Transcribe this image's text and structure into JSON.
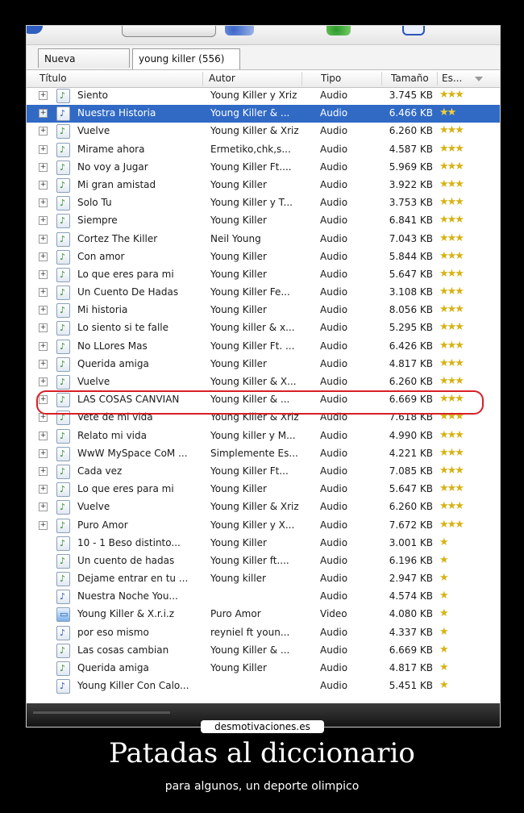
{
  "tabs": {
    "new_search": "Nueva búsqueda",
    "active": "young killer (556)"
  },
  "columns": {
    "title": "Título",
    "author": "Autor",
    "type": "Tipo",
    "size": "Tamaño",
    "status": "Es..."
  },
  "rows": [
    {
      "title": "Siento",
      "author": "Young Killer y Xriz",
      "type": "Audio",
      "size": "3.745 KB",
      "stars": 3,
      "expandable": true,
      "icon": "green"
    },
    {
      "title": "Nuestra Historia",
      "author": "Young Killer & ...",
      "type": "Audio",
      "size": "6.466 KB",
      "stars": 2,
      "expandable": true,
      "icon": "blue",
      "selected": true
    },
    {
      "title": "Vuelve",
      "author": "Young Killer & Xriz",
      "type": "Audio",
      "size": "6.260 KB",
      "stars": 3,
      "expandable": true,
      "icon": "green"
    },
    {
      "title": "Mirame ahora",
      "author": "Ermetiko,chk,s...",
      "type": "Audio",
      "size": "4.587 KB",
      "stars": 3,
      "expandable": true,
      "icon": "green"
    },
    {
      "title": "No voy a Jugar",
      "author": "Young Killer Ft....",
      "type": "Audio",
      "size": "5.969 KB",
      "stars": 3,
      "expandable": true,
      "icon": "green"
    },
    {
      "title": "Mi gran amistad",
      "author": "Young Killer",
      "type": "Audio",
      "size": "3.922 KB",
      "stars": 3,
      "expandable": true,
      "icon": "green"
    },
    {
      "title": "Solo Tu",
      "author": "Young Killer y T...",
      "type": "Audio",
      "size": "3.753 KB",
      "stars": 3,
      "expandable": true,
      "icon": "green"
    },
    {
      "title": "Siempre",
      "author": "Young Killer",
      "type": "Audio",
      "size": "6.841 KB",
      "stars": 3,
      "expandable": true,
      "icon": "green"
    },
    {
      "title": "Cortez The Killer",
      "author": "Neil Young",
      "type": "Audio",
      "size": "7.043 KB",
      "stars": 3,
      "expandable": true,
      "icon": "green"
    },
    {
      "title": "Con amor",
      "author": "Young Killer",
      "type": "Audio",
      "size": "5.844 KB",
      "stars": 3,
      "expandable": true,
      "icon": "green"
    },
    {
      "title": "Lo que eres para mi",
      "author": "Young Killer",
      "type": "Audio",
      "size": "5.647 KB",
      "stars": 3,
      "expandable": true,
      "icon": "green"
    },
    {
      "title": "Un Cuento De Hadas",
      "author": "Young Killer Fe...",
      "type": "Audio",
      "size": "3.108 KB",
      "stars": 3,
      "expandable": true,
      "icon": "green"
    },
    {
      "title": "Mi historia",
      "author": "Young Killer",
      "type": "Audio",
      "size": "8.056 KB",
      "stars": 3,
      "expandable": true,
      "icon": "green"
    },
    {
      "title": "Lo siento si te falle",
      "author": "Young killer & x...",
      "type": "Audio",
      "size": "5.295 KB",
      "stars": 3,
      "expandable": true,
      "icon": "green"
    },
    {
      "title": "No LLores Mas",
      "author": "Young Killer Ft. ...",
      "type": "Audio",
      "size": "6.426 KB",
      "stars": 3,
      "expandable": true,
      "icon": "green"
    },
    {
      "title": "Querida amiga",
      "author": "Young Killer",
      "type": "Audio",
      "size": "4.817 KB",
      "stars": 3,
      "expandable": true,
      "icon": "green"
    },
    {
      "title": "Vuelve",
      "author": "Young Killer & X...",
      "type": "Audio",
      "size": "6.260 KB",
      "stars": 3,
      "expandable": true,
      "icon": "green"
    },
    {
      "title": "LAS COSAS CANVIAN",
      "author": "Young Killer & ...",
      "type": "Audio",
      "size": "6.669 KB",
      "stars": 3,
      "expandable": true,
      "icon": "green",
      "highlighted": true
    },
    {
      "title": "Vete de mi vida",
      "author": "Young Killer & Xriz",
      "type": "Audio",
      "size": "7.618 KB",
      "stars": 3,
      "expandable": true,
      "icon": "green"
    },
    {
      "title": "Relato mi vida",
      "author": "Young killer y M...",
      "type": "Audio",
      "size": "4.990 KB",
      "stars": 3,
      "expandable": true,
      "icon": "green"
    },
    {
      "title": "WwW MySpace CoM ...",
      "author": "Simplemente Es...",
      "type": "Audio",
      "size": "4.221 KB",
      "stars": 3,
      "expandable": true,
      "icon": "green"
    },
    {
      "title": "Cada vez",
      "author": "Young Killer Ft...",
      "type": "Audio",
      "size": "7.085 KB",
      "stars": 3,
      "expandable": true,
      "icon": "green"
    },
    {
      "title": "Lo que eres para mi",
      "author": "Young Killer",
      "type": "Audio",
      "size": "5.647 KB",
      "stars": 3,
      "expandable": true,
      "icon": "green"
    },
    {
      "title": "Vuelve",
      "author": "Young Killer & Xriz",
      "type": "Audio",
      "size": "6.260 KB",
      "stars": 3,
      "expandable": true,
      "icon": "green"
    },
    {
      "title": "Puro Amor",
      "author": "Young Killer y X...",
      "type": "Audio",
      "size": "7.672 KB",
      "stars": 3,
      "expandable": true,
      "icon": "green"
    },
    {
      "title": "10 - 1 Beso distinto...",
      "author": "Young Killer",
      "type": "Audio",
      "size": "3.001 KB",
      "stars": 1,
      "expandable": false,
      "icon": "green"
    },
    {
      "title": "Un cuento de hadas",
      "author": "Young Killer ft....",
      "type": "Audio",
      "size": "6.196 KB",
      "stars": 1,
      "expandable": false,
      "icon": "green"
    },
    {
      "title": "Dejame entrar en tu ...",
      "author": "Young killer",
      "type": "Audio",
      "size": "2.947 KB",
      "stars": 1,
      "expandable": false,
      "icon": "green"
    },
    {
      "title": "Nuestra Noche      You...",
      "author": "",
      "type": "Audio",
      "size": "4.574 KB",
      "stars": 1,
      "expandable": false,
      "icon": "blue"
    },
    {
      "title": "Young Killer & X.r.i.z",
      "author": "Puro Amor",
      "type": "Video",
      "size": "4.080 KB",
      "stars": 1,
      "expandable": false,
      "icon": "video"
    },
    {
      "title": "por eso mismo",
      "author": "reyniel ft youn...",
      "type": "Audio",
      "size": "4.337 KB",
      "stars": 1,
      "expandable": false,
      "icon": "blue"
    },
    {
      "title": "Las cosas cambian",
      "author": "Young Killer & ...",
      "type": "Audio",
      "size": "6.669 KB",
      "stars": 1,
      "expandable": false,
      "icon": "green"
    },
    {
      "title": "Querida amiga",
      "author": "Young Killer",
      "type": "Audio",
      "size": "4.817 KB",
      "stars": 1,
      "expandable": false,
      "icon": "green"
    },
    {
      "title": "Young Killer Con Calo...",
      "author": "",
      "type": "Audio",
      "size": "5.451 KB",
      "stars": 1,
      "expandable": false,
      "icon": "blue"
    }
  ],
  "watermark": "desmotivaciones.es",
  "caption": "Patadas al diccionario",
  "subcaption": "para algunos, un deporte olimpico",
  "colors": {
    "selection": "#316ac5",
    "highlight_ring": "#d81f26",
    "stars": "#d6b314"
  }
}
